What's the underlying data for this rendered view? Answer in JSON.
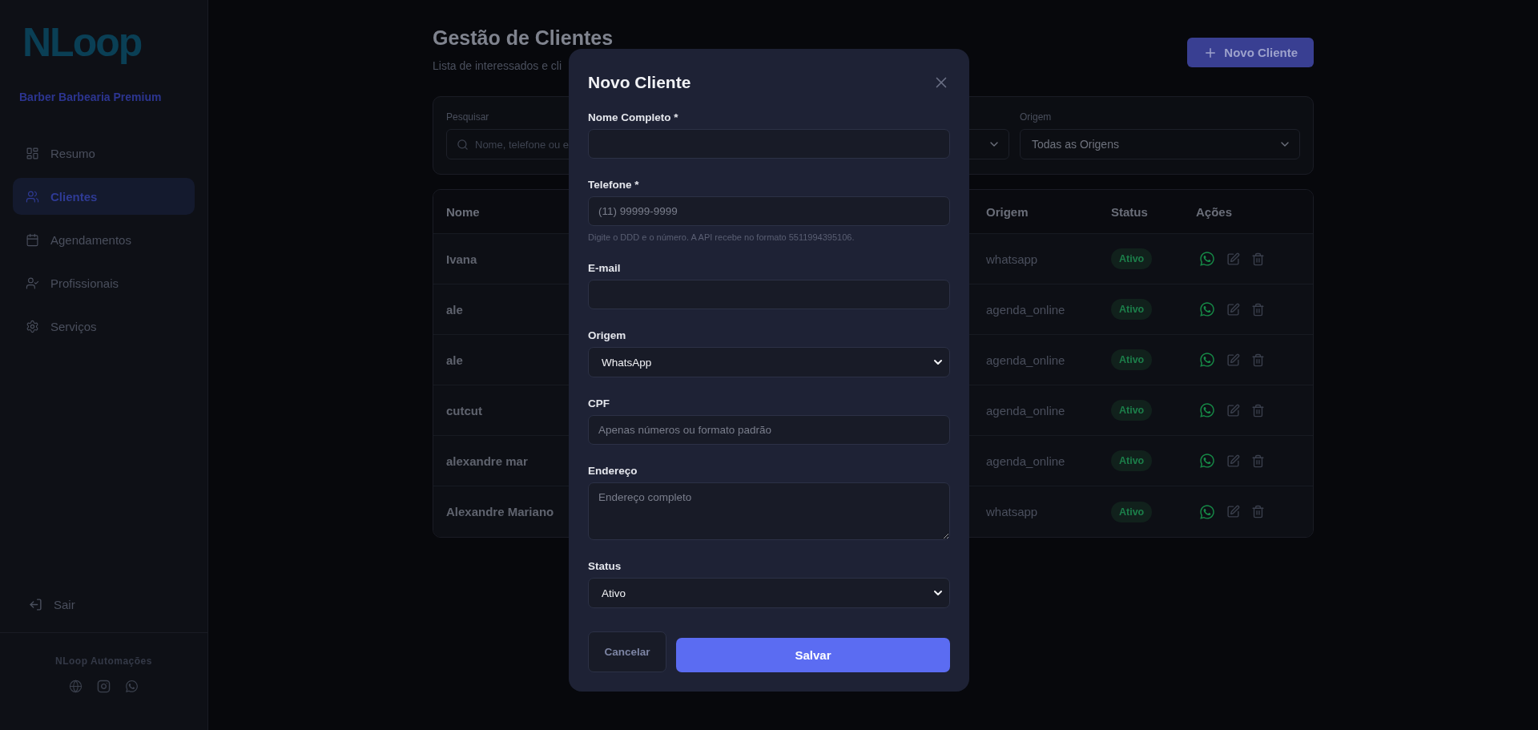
{
  "sidebar": {
    "logo": "NLoop",
    "business": "Barber Barbearia Premium",
    "items": [
      {
        "label": "Resumo",
        "kind": "dashboard",
        "selected": false
      },
      {
        "label": "Clientes",
        "kind": "users",
        "selected": true
      },
      {
        "label": "Agendamentos",
        "kind": "calendar",
        "selected": false
      },
      {
        "label": "Profissionais",
        "kind": "user-check",
        "selected": false
      },
      {
        "label": "Serviços",
        "kind": "settings",
        "selected": false
      }
    ],
    "logout": "Sair",
    "footer": "NLoop Automações"
  },
  "header": {
    "title": "Gestão de Clientes",
    "subtitle": "Lista de interessados e cli",
    "new_button": "Novo Cliente"
  },
  "filters": {
    "search_label": "Pesquisar",
    "search_placeholder": "Nome, telefone ou e",
    "origin_label": "Origem",
    "origin_value": "Todas as Origens"
  },
  "table": {
    "columns": [
      "Nome",
      "Origem",
      "Status",
      "Ações"
    ],
    "rows": [
      {
        "name": "Ivana",
        "origin": "whatsapp",
        "status": "Ativo"
      },
      {
        "name": "ale",
        "origin": "agenda_online",
        "status": "Ativo"
      },
      {
        "name": "ale",
        "origin": "agenda_online",
        "status": "Ativo"
      },
      {
        "name": "cutcut",
        "origin": "agenda_online",
        "status": "Ativo"
      },
      {
        "name": "alexandre mar",
        "origin": "agenda_online",
        "status": "Ativo"
      },
      {
        "name": "Alexandre Mariano",
        "origin": "whatsapp",
        "status": "Ativo"
      }
    ]
  },
  "modal": {
    "title": "Novo Cliente",
    "fields": [
      {
        "kind": "input",
        "label": "Nome Completo *"
      },
      {
        "kind": "input",
        "label": "Telefone *",
        "placeholder": "(11) 99999-9999",
        "hint": "Digite o DDD e o número. A API recebe no formato 5511994395106."
      },
      {
        "kind": "input",
        "label": "E-mail"
      },
      {
        "kind": "select",
        "label": "Origem",
        "value": "WhatsApp"
      },
      {
        "kind": "input",
        "label": "CPF",
        "placeholder": "Apenas números ou formato padrão"
      },
      {
        "kind": "textarea",
        "label": "Endereço",
        "placeholder": "Endereço completo"
      },
      {
        "kind": "select",
        "label": "Status",
        "value": "Ativo"
      }
    ],
    "cancel": "Cancelar",
    "save": "Salvar"
  }
}
